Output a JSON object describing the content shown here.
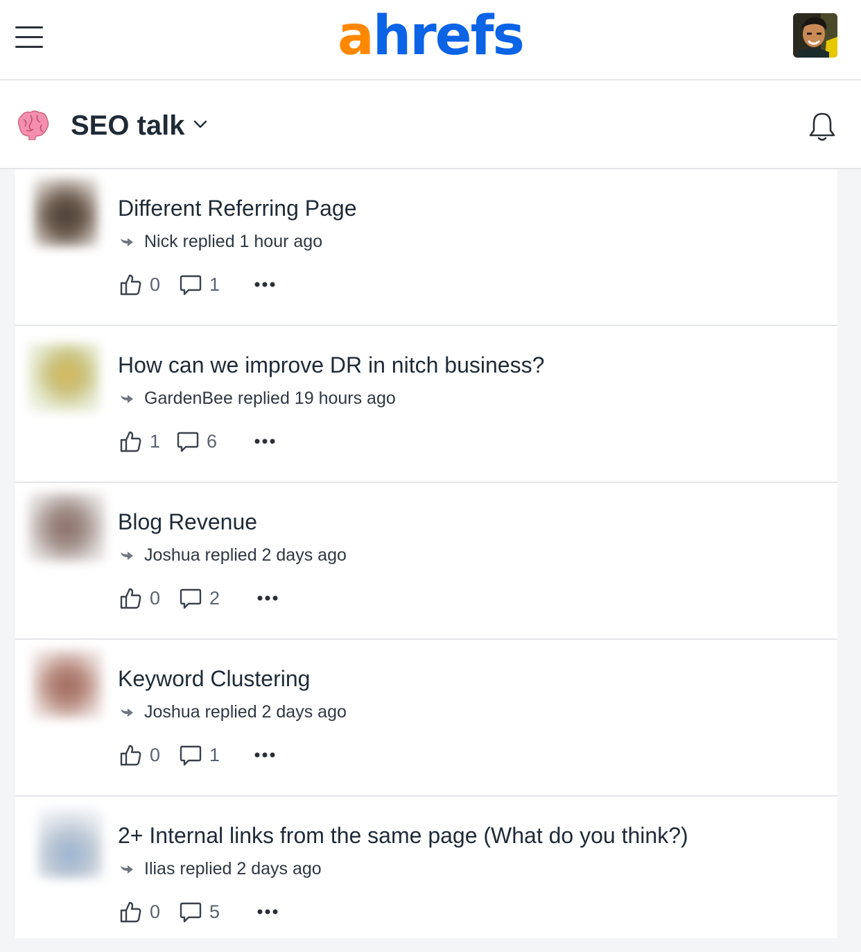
{
  "header": {
    "logo_a": "a",
    "logo_rest": "hrefs",
    "menu_icon": "hamburger-menu-icon",
    "avatar_icon": "user-avatar"
  },
  "forum": {
    "title": "SEO talk",
    "emoji_icon": "brain-icon",
    "dropdown_icon": "chevron-down-icon",
    "notifications_icon": "bell-icon"
  },
  "colors": {
    "logo_orange": "#ff8800",
    "logo_blue": "#0b63e6",
    "text": "#1f2a37",
    "muted": "#5a6270",
    "divider": "#e3e5e8"
  },
  "threads": [
    {
      "title": "Different Referring Page",
      "reply_text": "Nick replied 1 hour ago",
      "likes": "0",
      "comments": "1"
    },
    {
      "title": "How can we improve DR in nitch business?",
      "reply_text": "GardenBee replied 19 hours ago",
      "likes": "1",
      "comments": "6"
    },
    {
      "title": "Blog Revenue",
      "reply_text": "Joshua replied 2 days ago",
      "likes": "0",
      "comments": "2"
    },
    {
      "title": "Keyword Clustering",
      "reply_text": "Joshua replied 2 days ago",
      "likes": "0",
      "comments": "1"
    },
    {
      "title": "2+ Internal links from the same page (What do you think?)",
      "reply_text": "Ilias replied 2 days ago",
      "likes": "0",
      "comments": "5"
    }
  ]
}
